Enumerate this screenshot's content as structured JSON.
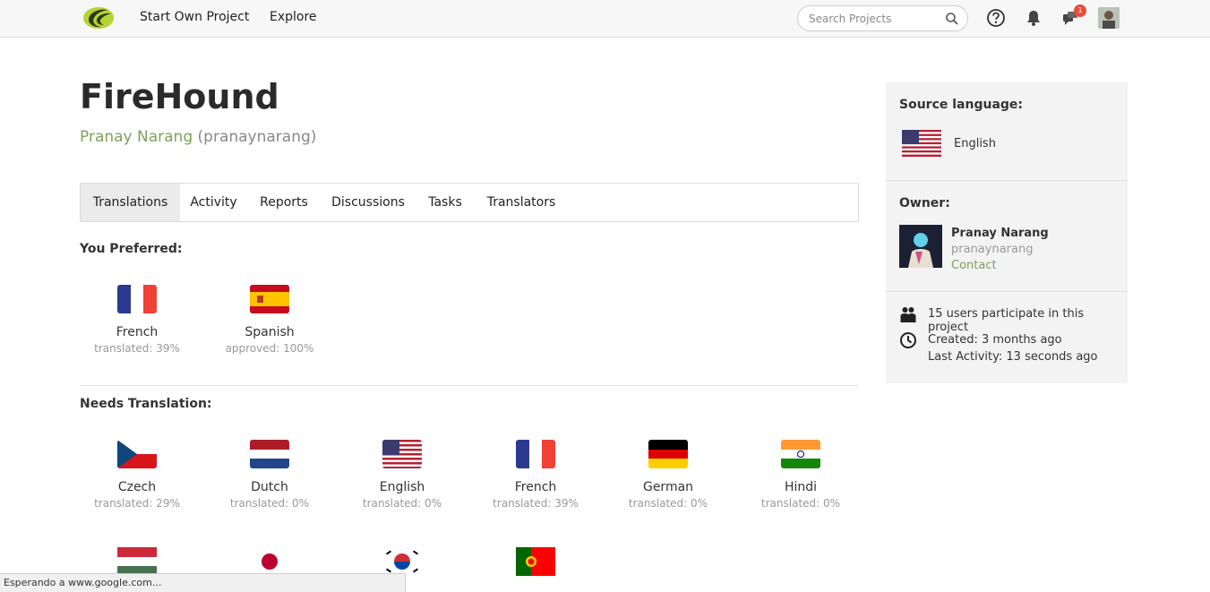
{
  "nav": {
    "start_project": "Start Own Project",
    "explore": "Explore",
    "search_placeholder": "Search Projects",
    "notification_badge": "1"
  },
  "project": {
    "title": "FireHound",
    "owner_name": "Pranay Narang",
    "owner_username": "(pranaynarang)"
  },
  "tabs": [
    "Translations",
    "Activity",
    "Reports",
    "Discussions",
    "Tasks",
    "Translators"
  ],
  "preferred": {
    "label": "You Preferred:",
    "items": [
      {
        "name": "French",
        "status": "translated: 39%"
      },
      {
        "name": "Spanish",
        "status": "approved: 100%"
      }
    ]
  },
  "needs": {
    "label": "Needs Translation:",
    "items": [
      {
        "name": "Czech",
        "status": "translated: 29%"
      },
      {
        "name": "Dutch",
        "status": "translated: 0%"
      },
      {
        "name": "English",
        "status": "translated: 0%"
      },
      {
        "name": "French",
        "status": "translated: 39%"
      },
      {
        "name": "German",
        "status": "translated: 0%"
      },
      {
        "name": "Hindi",
        "status": "translated: 0%"
      }
    ]
  },
  "sidebar": {
    "source_label": "Source language:",
    "source_language": "English",
    "owner_label": "Owner:",
    "owner_name": "Pranay Narang",
    "owner_username": "pranaynarang",
    "contact": "Contact",
    "participants": "15 users participate in this project",
    "created": "Created: 3 months ago",
    "last_activity": "Last Activity: 13 seconds ago"
  },
  "status_bar": "Esperando a www.google.com...",
  "colors": {
    "accent_green": "#7aa35a",
    "badge_red": "#e74c3c"
  }
}
